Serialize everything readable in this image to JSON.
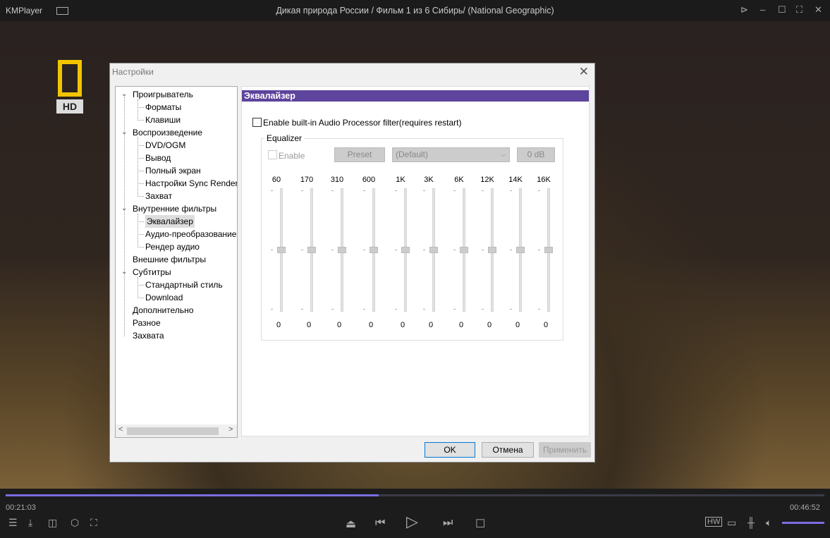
{
  "window": {
    "app": "KMPlayer",
    "title": "Дикая природа России / Фильм 1 из 6 Сибирь/ (National Geographic)"
  },
  "video": {
    "logo_text": "HD"
  },
  "dialog": {
    "title": "Настройки",
    "tree": [
      {
        "label": "Проигрыватель",
        "level": 0,
        "expanded": true
      },
      {
        "label": "Форматы",
        "level": 1
      },
      {
        "label": "Клавиши",
        "level": 1
      },
      {
        "label": "Воспроизведение",
        "level": 0,
        "expanded": true
      },
      {
        "label": "DVD/OGM",
        "level": 1
      },
      {
        "label": "Вывод",
        "level": 1
      },
      {
        "label": "Полный экран",
        "level": 1
      },
      {
        "label": "Настройки Sync Render",
        "level": 1
      },
      {
        "label": "Захват",
        "level": 1
      },
      {
        "label": "Внутренние фильтры",
        "level": 0,
        "expanded": true
      },
      {
        "label": "Эквалайзер",
        "level": 1,
        "selected": true
      },
      {
        "label": "Аудио-преобразование",
        "level": 1
      },
      {
        "label": "Рендер аудио",
        "level": 1
      },
      {
        "label": "Внешние фильтры",
        "level": 0
      },
      {
        "label": "Субтитры",
        "level": 0,
        "expanded": true
      },
      {
        "label": "Стандартный стиль",
        "level": 1
      },
      {
        "label": "Download",
        "level": 1
      },
      {
        "label": "Дополнительно",
        "level": 0
      },
      {
        "label": "Разное",
        "level": 0
      },
      {
        "label": "Захвата",
        "level": 0
      }
    ],
    "panel": {
      "header": "Эквалайзер",
      "audio_processor_label": "Enable built-in Audio Processor filter(requires restart)",
      "audio_processor_checked": false,
      "group_title": "Equalizer",
      "enable_label": "Enable",
      "enable_checked": false,
      "preset_label": "Preset",
      "preset_value": "(Default)",
      "db_label": "0 dB",
      "bands": [
        {
          "freq": "60",
          "value": "0"
        },
        {
          "freq": "170",
          "value": "0"
        },
        {
          "freq": "310",
          "value": "0"
        },
        {
          "freq": "600",
          "value": "0"
        },
        {
          "freq": "1K",
          "value": "0"
        },
        {
          "freq": "3K",
          "value": "0"
        },
        {
          "freq": "6K",
          "value": "0"
        },
        {
          "freq": "12K",
          "value": "0"
        },
        {
          "freq": "14K",
          "value": "0"
        },
        {
          "freq": "16K",
          "value": "0"
        }
      ]
    },
    "buttons": {
      "ok": "OK",
      "cancel": "Отмена",
      "apply": "Применить"
    }
  },
  "player": {
    "elapsed": "00:21:03",
    "total": "00:46:52",
    "progress_percent": 45.6,
    "accent": "#7b6ee0"
  }
}
